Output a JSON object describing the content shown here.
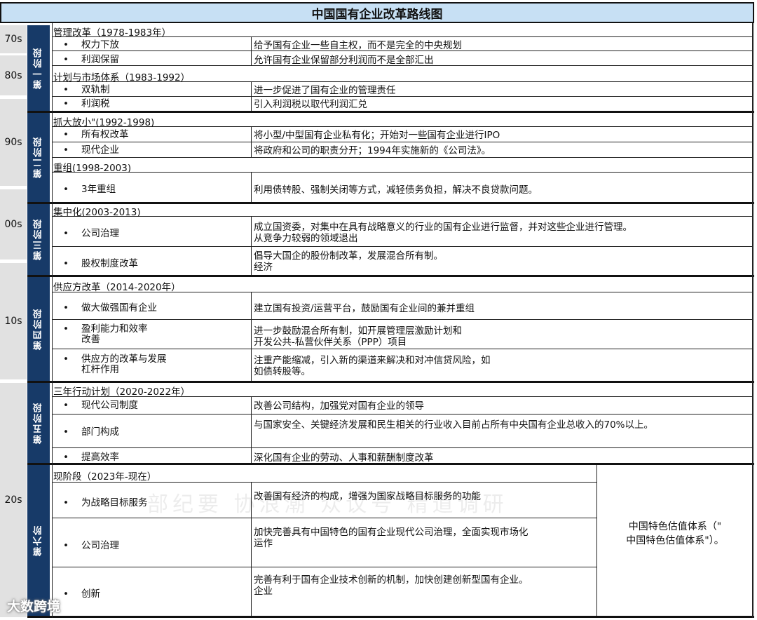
{
  "title": "中国国有企业改革路线图",
  "decades": [
    "70s",
    "80s",
    "90s",
    "00s",
    "10s",
    "20s"
  ],
  "stages": [
    "第一阶段",
    "第二阶段",
    "第三阶段",
    "第四阶段",
    "第五阶段",
    "第六阶"
  ],
  "phases": [
    "管理改革（1978-1983年）",
    "计划与市场体系（1983-1992）",
    "抓大放小\"(1992-1998)",
    "重组(1998-2003)",
    "集中化(2003-2013)",
    "供应方改革（2014-2020年）",
    "三年行动计划（2020-2022年）",
    "现阶段（2023年-现在）"
  ],
  "bullet": "•",
  "rows": [
    {
      "item": "权力下放",
      "desc": "给予国有企业一些自主权，而不是完全的中央规划"
    },
    {
      "item": "利润保留",
      "desc": "允许国有企业保留部分利润而不是全部汇出"
    },
    {
      "item": "双轨制",
      "desc": "进一步促进了国有企业的管理责任"
    },
    {
      "item": "利润税",
      "desc": "引入利润税以取代利润汇兑"
    },
    {
      "item": "所有权改革",
      "desc": "将小型/中型国有企业私有化；开始对一些国有企业进行IPO"
    },
    {
      "item": "现代企业",
      "desc": "将政府和公司的职责分开；1994年实施新的《公司法》。"
    },
    {
      "item": "3年重组",
      "desc": "利用债转股、强制关闭等方式，减轻债务负担，解决不良贷款问题。"
    },
    {
      "item": "公司治理",
      "desc": "成立国资委，对集中在具有战略意义的行业的国有企业进行监督，并对这些企业进行管理。",
      "desc2": "从竞争力较弱的领域退出"
    },
    {
      "item": "股权制度改革",
      "desc": "倡导大国企的股份制改革，发展混合所有制。",
      "desc2": "经济"
    },
    {
      "item": "做大做强国有企业",
      "desc": "建立国有投资/运营平台，鼓励国有企业间的兼并重组"
    },
    {
      "item": "盈利能力和效率",
      "item2": "改善",
      "desc": "进一步鼓励混合所有制，如开展管理层激励计划和",
      "desc2": "开发公共-私营伙伴关系（PPP）项目"
    },
    {
      "item": "供应方的改革与发展",
      "item2": "杠杆作用",
      "desc": "注重产能缩减，引入新的渠道来解决和对冲信贷风险，如",
      "desc2": "如债转股等。"
    },
    {
      "item": "现代公司制度",
      "desc": "改善公司结构，加强党对国有企业的领导"
    },
    {
      "item": "部门构成",
      "desc": "与国家安全、关键经济发展和民生相关的行业收入目前占所有中央国有企业总收入的70%以上。"
    },
    {
      "item": "提高效率",
      "desc": "深化国有企业的劳动、人事和薪酬制度改革"
    },
    {
      "item": "为战略目标服务",
      "desc": "改善国有经济的构成，增强为国家战略目标服务的功能"
    },
    {
      "item": "公司治理",
      "desc": "加快完善具有中国特色的国有企业现代公司治理，全面实现市场化",
      "desc2": "运作"
    },
    {
      "item": "创新",
      "desc": "完善有利于国有企业技术创新的机制，加快创建创新型国有企业。",
      "desc2": "企业"
    }
  ],
  "side_note": [
    "中国特色估值体系（\"",
    "中国特色估值体系\"）。"
  ],
  "watermark": "部纪要  协浪潮  众议号  精道调研",
  "logo": "大数跨境"
}
